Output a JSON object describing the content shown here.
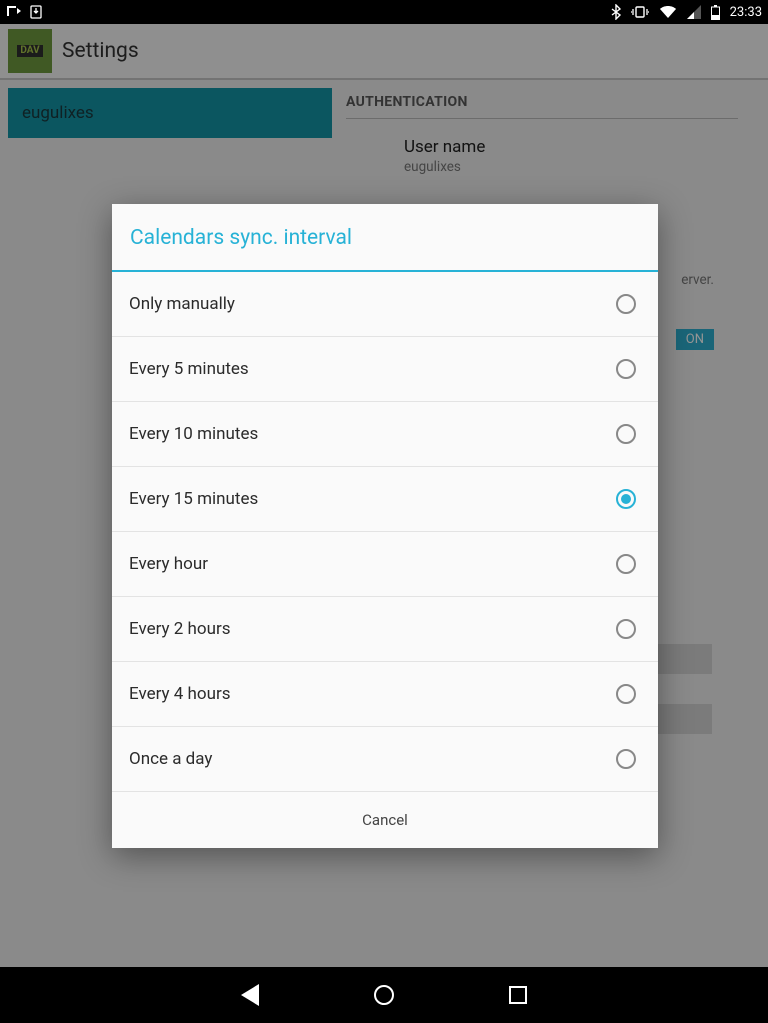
{
  "status": {
    "time": "23:33"
  },
  "app": {
    "title": "Settings"
  },
  "sidebar": {
    "account": "eugulixes"
  },
  "detail": {
    "section": "AUTHENTICATION",
    "username_label": "User name",
    "username_value": "eugulixes",
    "server_tail": "erver.",
    "toggle": "ON"
  },
  "dialog": {
    "title": "Calendars sync. interval",
    "options": [
      {
        "label": "Only manually",
        "selected": false
      },
      {
        "label": "Every 5 minutes",
        "selected": false
      },
      {
        "label": "Every 10 minutes",
        "selected": false
      },
      {
        "label": "Every 15 minutes",
        "selected": true
      },
      {
        "label": "Every hour",
        "selected": false
      },
      {
        "label": "Every 2 hours",
        "selected": false
      },
      {
        "label": "Every 4 hours",
        "selected": false
      },
      {
        "label": "Once a day",
        "selected": false
      }
    ],
    "cancel": "Cancel"
  }
}
